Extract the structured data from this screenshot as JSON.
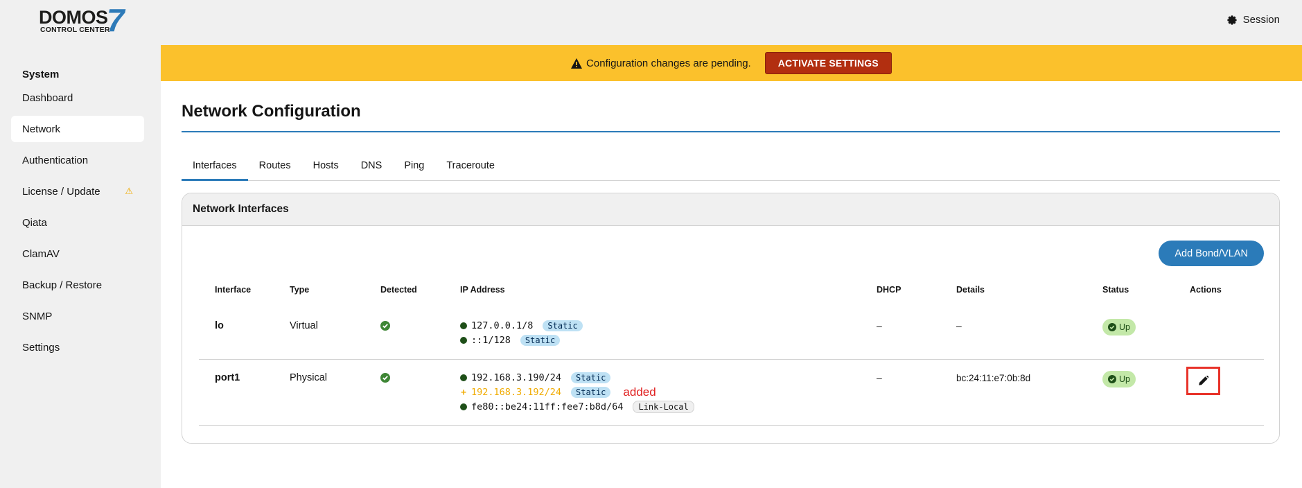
{
  "logo": {
    "brand_part1": "DOM",
    "brand_part2": "OS",
    "brand_number": "7",
    "subtitle": "CONTROL CENTER"
  },
  "session": {
    "label": "Session",
    "icon": "gear-icon"
  },
  "sidebar": {
    "section_title": "System",
    "items": [
      {
        "label": "Dashboard",
        "active": false
      },
      {
        "label": "Network",
        "active": true
      },
      {
        "label": "Authentication",
        "active": false
      },
      {
        "label": "License / Update",
        "active": false,
        "warning": "⚠"
      },
      {
        "label": "Qiata",
        "active": false
      },
      {
        "label": "ClamAV",
        "active": false
      },
      {
        "label": "Backup / Restore",
        "active": false
      },
      {
        "label": "SNMP",
        "active": false
      },
      {
        "label": "Settings",
        "active": false
      }
    ]
  },
  "banner": {
    "message": "Configuration changes are pending.",
    "button_label": "ACTIVATE SETTINGS",
    "icon": "warning-triangle-icon",
    "color": "#fbc12c",
    "button_color": "#b22f10"
  },
  "page": {
    "title": "Network Configuration"
  },
  "tabs": [
    {
      "label": "Interfaces",
      "active": true
    },
    {
      "label": "Routes",
      "active": false
    },
    {
      "label": "Hosts",
      "active": false
    },
    {
      "label": "DNS",
      "active": false
    },
    {
      "label": "Ping",
      "active": false
    },
    {
      "label": "Traceroute",
      "active": false
    }
  ],
  "card": {
    "title": "Network Interfaces",
    "add_button": "Add Bond/VLAN",
    "columns": [
      "Interface",
      "Type",
      "Detected",
      "IP Address",
      "DHCP",
      "Details",
      "Status",
      "Actions"
    ],
    "rows": [
      {
        "interface": "lo",
        "type": "Virtual",
        "detected": true,
        "ips": [
          {
            "address": "127.0.0.1/8",
            "tag": "Static"
          },
          {
            "address": "::1/128",
            "tag": "Static"
          }
        ],
        "dhcp": "–",
        "details": "–",
        "status": "Up"
      },
      {
        "interface": "port1",
        "type": "Physical",
        "detected": true,
        "ips": [
          {
            "address": "192.168.3.190/24",
            "tag": "Static"
          },
          {
            "prefix": "+",
            "address": "192.168.3.192/24",
            "tag": "Static",
            "annotation": "added"
          },
          {
            "address": "fe80::be24:11ff:fee7:b8d/64",
            "tag": "Link-Local"
          }
        ],
        "dhcp": "–",
        "details": "bc:24:11:e7:0b:8d",
        "status": "Up"
      }
    ]
  },
  "colors": {
    "accent": "#2b7bb9",
    "status_up": "#c3e8a8",
    "pending": "#f0ab00",
    "highlight": "#e8332a"
  }
}
